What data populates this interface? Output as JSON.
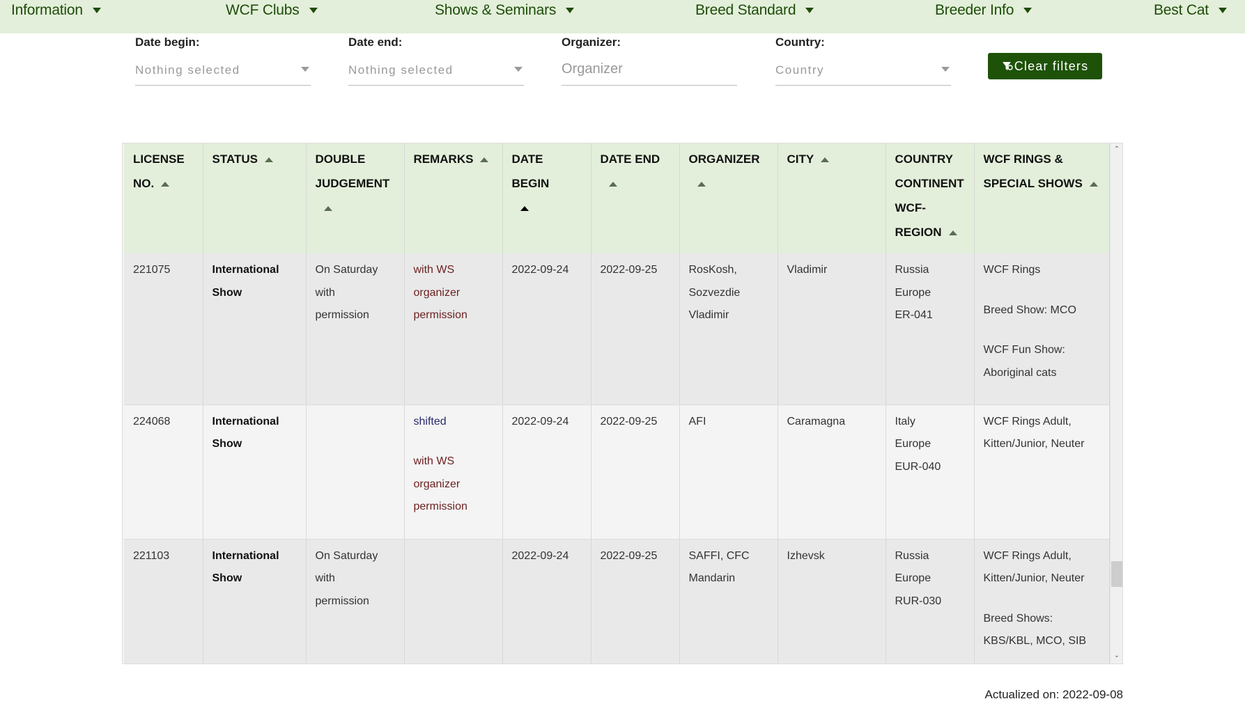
{
  "nav": {
    "items": [
      {
        "label": "Information"
      },
      {
        "label": "WCF Clubs"
      },
      {
        "label": "Shows & Seminars"
      },
      {
        "label": "Breed Standard"
      },
      {
        "label": "Breeder Info"
      },
      {
        "label": "Best Cat"
      }
    ],
    "icon": "caret-down-icon"
  },
  "filters": {
    "date_begin": {
      "label": "Date begin:",
      "value": "Nothing selected"
    },
    "date_end": {
      "label": "Date end:",
      "value": "Nothing selected"
    },
    "organizer": {
      "label": "Organizer:",
      "placeholder": "Organizer",
      "value": ""
    },
    "country": {
      "label": "Country:",
      "value": "Country"
    },
    "clear_button": {
      "label": "Clear filters",
      "icon": "filter-clear-icon"
    }
  },
  "colors": {
    "nav_bg": "#e3efda",
    "nav_text": "#1e4d0a",
    "button_bg": "#1e5209",
    "header_bg": "#e3efda",
    "remark_red": "#6b1f1f",
    "remark_blue": "#2a2a6e"
  },
  "table": {
    "columns": [
      {
        "lines": [
          "LICENSE",
          "NO."
        ],
        "sort": "asc"
      },
      {
        "lines": [
          "STATUS"
        ],
        "sort": "asc"
      },
      {
        "lines": [
          "DOUBLE",
          "JUDGEMENT"
        ],
        "sort": "asc"
      },
      {
        "lines": [
          "REMARKS"
        ],
        "sort": "asc"
      },
      {
        "lines": [
          "DATE BEGIN"
        ],
        "sort": "asc-active"
      },
      {
        "lines": [
          "DATE END"
        ],
        "sort": "asc"
      },
      {
        "lines": [
          "ORGANIZER"
        ],
        "sort": "asc"
      },
      {
        "lines": [
          "CITY"
        ],
        "sort": "asc"
      },
      {
        "lines": [
          "COUNTRY",
          "CONTINENT",
          "WCF-",
          "REGION"
        ],
        "sort": "asc"
      },
      {
        "lines": [
          "WCF RINGS &",
          "SPECIAL SHOWS"
        ],
        "sort": "asc"
      }
    ],
    "rows": [
      {
        "license": "221075",
        "status": [
          "International",
          "Show"
        ],
        "double_judgement": [
          "On Saturday",
          "with",
          "permission"
        ],
        "remarks": [
          {
            "text": [
              "with WS",
              "organizer",
              "permission"
            ],
            "tone": "red"
          }
        ],
        "date_begin": "2022-09-24",
        "date_end": "2022-09-25",
        "organizer": [
          "RosKosh,",
          "Sozvezdie",
          "Vladimir"
        ],
        "city": "Vladimir",
        "country": [
          "Russia",
          "Europe",
          "ER-041"
        ],
        "rings": [
          [
            "WCF Rings"
          ],
          [
            "Breed Show: MCO"
          ],
          [
            "WCF Fun Show:",
            "Aboriginal cats"
          ]
        ]
      },
      {
        "license": "224068",
        "status": [
          "International",
          "Show"
        ],
        "double_judgement": [],
        "remarks": [
          {
            "text": [
              "shifted"
            ],
            "tone": "blue"
          },
          {
            "text": [
              "with WS",
              "organizer",
              "permission"
            ],
            "tone": "red"
          }
        ],
        "date_begin": "2022-09-24",
        "date_end": "2022-09-25",
        "organizer": [
          "AFI"
        ],
        "city": "Caramagna",
        "country": [
          "Italy",
          "Europe",
          "EUR-040"
        ],
        "rings": [
          [
            "WCF Rings Adult,",
            "Kitten/Junior, Neuter"
          ]
        ]
      },
      {
        "license": "221103",
        "status": [
          "International",
          "Show"
        ],
        "double_judgement": [
          "On Saturday",
          "with",
          "permission"
        ],
        "remarks": [],
        "date_begin": "2022-09-24",
        "date_end": "2022-09-25",
        "organizer": [
          "SAFFI, CFC",
          "Mandarin"
        ],
        "city": "Izhevsk",
        "country": [
          "Russia",
          "Europe",
          "RUR-030"
        ],
        "rings": [
          [
            "WCF Rings Adult,",
            "Kitten/Junior, Neuter"
          ],
          [
            "Breed Shows:",
            "KBS/KBL, MCO, SIB"
          ]
        ]
      }
    ]
  },
  "footer": {
    "actualized": "Actualized on: 2022-09-08"
  }
}
